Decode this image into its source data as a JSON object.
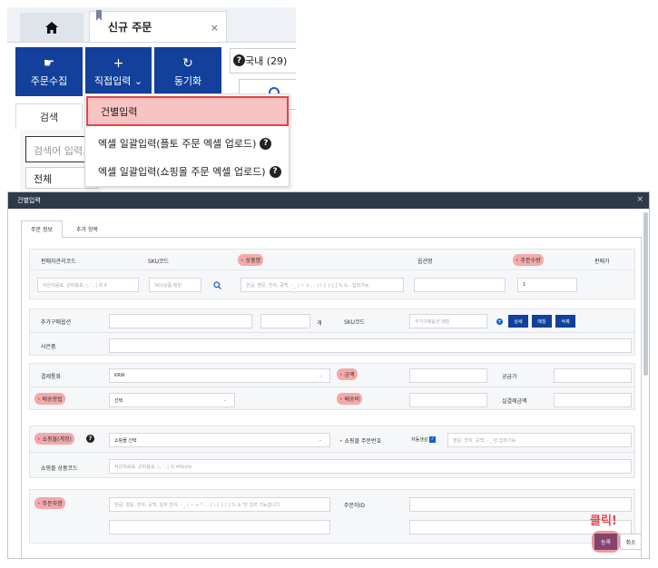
{
  "app": {
    "tab_title": "신규 주문",
    "tab_close": "×",
    "toolbar": {
      "collect_label": "주문수집",
      "direct_label": "직접입력",
      "direct_chevron": "⌄",
      "sync_label": "동기화"
    },
    "domestic_label": "국내 (29)",
    "search_tab_label": "검색",
    "search_placeholder": "검색어 입력...",
    "all_select_value": "전체"
  },
  "dropdown": {
    "items": [
      {
        "label": "건별입력"
      },
      {
        "label": "엑셀 일괄입력(플토 주문 엑셀 업로드)"
      },
      {
        "label": "엑셀 일괄입력(쇼핑몰 주문 엑셀 업로드)"
      }
    ],
    "help_glyph": "?"
  },
  "modal": {
    "title": "건별입력",
    "close": "×",
    "tabs": [
      {
        "label": "주문 정보"
      },
      {
        "label": "추가 항목"
      }
    ],
    "product_header": {
      "seller_code": "판매자관리코드",
      "sku_code": "SKU코드",
      "product_name": "상품명",
      "option_name": "옵션명",
      "order_qty": "주문수량",
      "sale_price": "판매가"
    },
    "product_row": {
      "seller_code_placeholder": "작은따옴표, 큰따옴표, \\, `, | 외 4",
      "sku_placeholder": "SKU상품 매칭",
      "product_name_placeholder": "한글, 영문, 숫자, 공백, - _ / ~ + , . ( ) { } [ ] % & : 입력가능",
      "qty_value": "1"
    },
    "additional": {
      "extra_product_label": "추가구매옵션",
      "count_unit": "개",
      "sku_label": "SKU코드",
      "extra_option_placeholder": "추가구매옵션 매칭",
      "btn_detail": "상세",
      "btn_match": "매칭",
      "btn_delete": "삭제",
      "gift_label": "사은품"
    },
    "payment": {
      "currency_label": "결제통화",
      "currency_value": "KRW",
      "amount_label": "금액",
      "supply_price_label": "공급가",
      "delivery_method_label": "배송방법",
      "delivery_method_value": "선택",
      "shipping_fee_label": "배송비",
      "actual_payment_label": "실결제금액"
    },
    "mall": {
      "mall_label": "쇼핑몰(계정)",
      "mall_value": "쇼핑몰 선택",
      "mall_order_no_label": "쇼핑몰 주문번호",
      "auto_generate_label": "자동생성",
      "mall_order_no_placeholder": "영문, 숫자, 공백, - _ 만 입력가능",
      "mall_product_code_label": "쇼핑몰 상품코드",
      "mall_product_code_placeholder": "작은따옴표, 큰따옴표, \\, `, | 외 40byte"
    },
    "orderer": {
      "orderer_name_label": "주문자명",
      "orderer_name_placeholder": "한글, 영문, 숫자, 공백, 일부 한자, - _ / ~ + * , . ( ) { } [ ] % & '만 입력 가능합니다",
      "orderer_id_label": "주문자ID"
    },
    "footer": {
      "click_hint": "클릭!",
      "register_label": "등록",
      "cancel_label": "취소"
    }
  }
}
